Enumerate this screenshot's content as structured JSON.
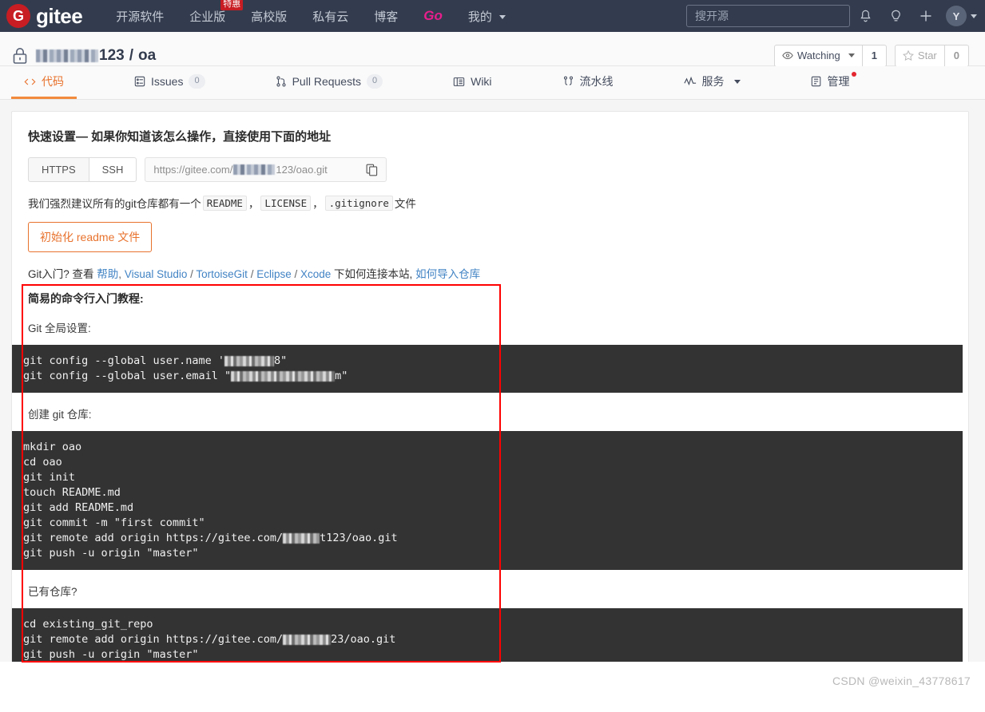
{
  "topnav": {
    "logo_letter": "G",
    "logo_text": "gitee",
    "links": [
      {
        "label": "开源软件",
        "badge": null,
        "caret": false
      },
      {
        "label": "企业版",
        "badge": "特惠",
        "caret": false
      },
      {
        "label": "高校版",
        "badge": null,
        "caret": false
      },
      {
        "label": "私有云",
        "badge": null,
        "caret": false
      },
      {
        "label": "博客",
        "badge": null,
        "caret": false
      },
      {
        "label": "Go",
        "badge": null,
        "caret": false
      },
      {
        "label": "我的",
        "badge": null,
        "caret": true
      }
    ],
    "search_placeholder": "搜开源",
    "icons": [
      "bell-icon",
      "lightbulb-icon",
      "plus-icon"
    ],
    "avatar_letter": "Y"
  },
  "repo": {
    "lock": "lock-icon",
    "owner_redacted": "██████",
    "owner_suffix": "123",
    "separator": "/",
    "name": "oa",
    "watch_label": "Watching",
    "watch_count": "1",
    "star_label": "Star",
    "star_count": "0"
  },
  "tabs": [
    {
      "label": "代码",
      "icon": "code-icon",
      "count": null,
      "active": true,
      "caret": false,
      "dot": false
    },
    {
      "label": "Issues",
      "icon": "issue-icon",
      "count": "0",
      "active": false,
      "caret": false,
      "dot": false
    },
    {
      "label": "Pull Requests",
      "icon": "pull-request-icon",
      "count": "0",
      "active": false,
      "caret": false,
      "dot": false
    },
    {
      "label": "Wiki",
      "icon": "wiki-icon",
      "count": null,
      "active": false,
      "caret": false,
      "dot": false
    },
    {
      "label": "流水线",
      "icon": "pipeline-icon",
      "count": null,
      "active": false,
      "caret": false,
      "dot": false
    },
    {
      "label": "服务",
      "icon": "service-icon",
      "count": null,
      "active": false,
      "caret": true,
      "dot": false
    },
    {
      "label": "管理",
      "icon": "manage-icon",
      "count": null,
      "active": false,
      "caret": false,
      "dot": true
    }
  ],
  "quickstart": {
    "title": "快速设置— 如果你知道该怎么操作，直接使用下面的地址",
    "proto_https": "HTTPS",
    "proto_ssh": "SSH",
    "url_prefix": "https://gitee.com/",
    "url_suffix": "123/oao.git",
    "copy_icon": "copy-icon",
    "recommend_prefix": "我们强烈建议所有的git仓库都有一个",
    "chip_readme": "README",
    "chip_license": "LICENSE",
    "chip_gitignore": ".gitignore",
    "recommend_suffix": "文件",
    "comma": "，",
    "init_button": "初始化 readme 文件",
    "git_intro": "Git入门?",
    "view": "查看",
    "help_link": "帮助",
    "ide_links": [
      "Visual Studio",
      "TortoiseGit",
      "Eclipse",
      "Xcode"
    ],
    "connect_text": "下如何连接本站,",
    "import_link": "如何导入仓库"
  },
  "tutorial": {
    "title": "简易的命令行入门教程:",
    "section_global": "Git 全局设置:",
    "global_cmds": {
      "line1_prefix": "git config --global user.name '",
      "line1_suffix": "8\"",
      "line2_prefix": "git config --global user.email \"",
      "line2_suffix": "m\""
    },
    "section_create": "创建 git 仓库:",
    "create_cmds": {
      "lines": [
        "mkdir oao",
        "cd oao",
        "git init",
        "touch README.md",
        "git add README.md",
        "git commit -m \"first commit\""
      ],
      "remote_prefix": "git remote add origin https://gitee.com/",
      "remote_suffix": "t123/oao.git",
      "push": "git push -u origin \"master\""
    },
    "section_existing": "已有仓库?",
    "existing_cmds": {
      "cd": "cd existing_git_repo",
      "remote_prefix": "git remote add origin https://gitee.com/",
      "remote_suffix": "23/oao.git",
      "push": "git push -u origin \"master\""
    }
  },
  "watermark": "CSDN @weixin_43778617"
}
